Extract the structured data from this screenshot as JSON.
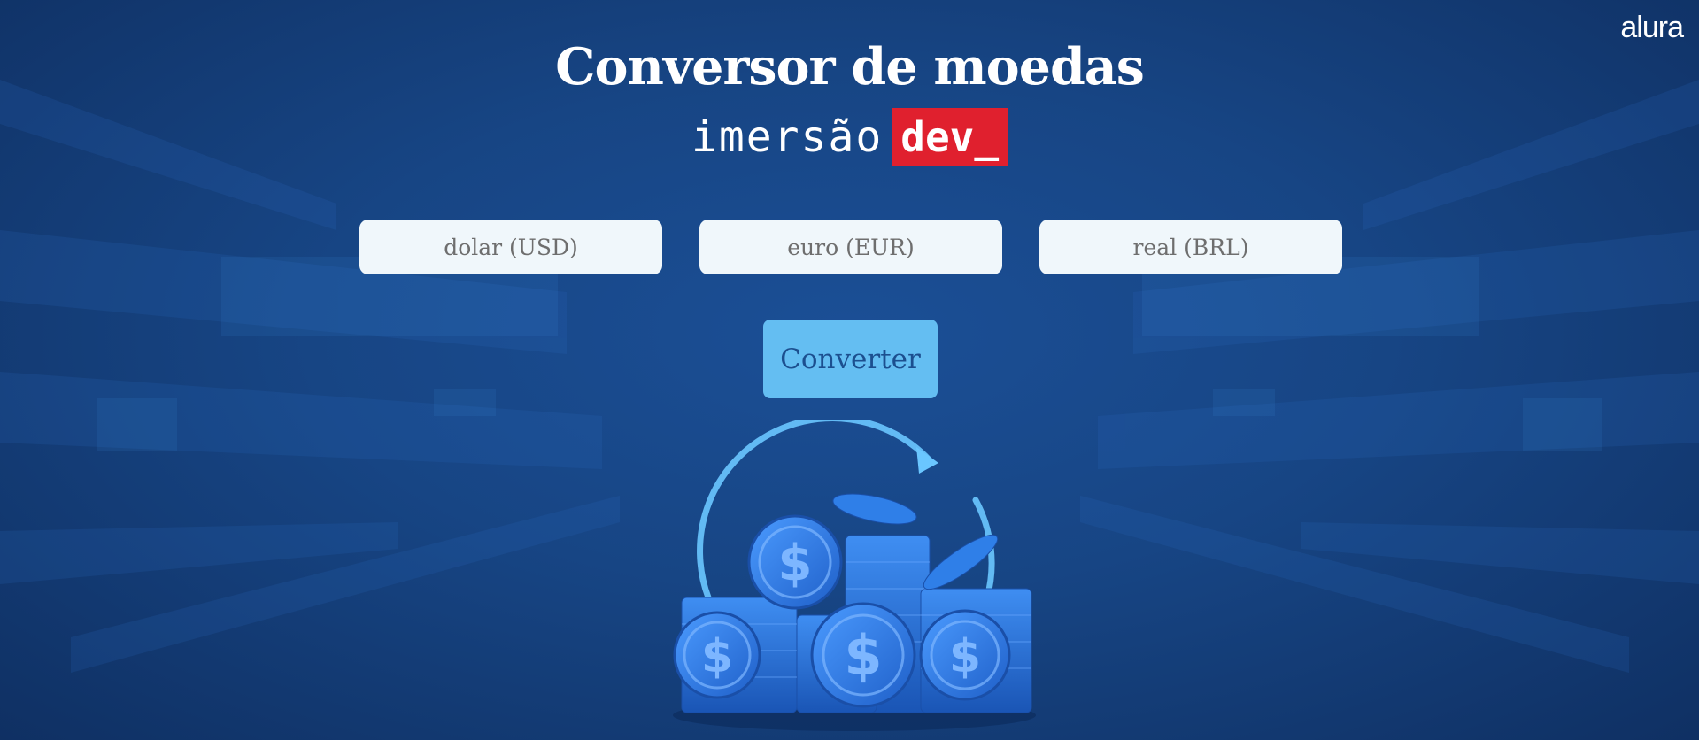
{
  "header": {
    "logo_text": "alura",
    "title": "Conversor de moedas",
    "subtitle_text": "imersão",
    "subtitle_badge": "dev_"
  },
  "form": {
    "fields": [
      {
        "placeholder": "dolar (USD)",
        "value": ""
      },
      {
        "placeholder": "euro (EUR)",
        "value": ""
      },
      {
        "placeholder": "real (BRL)",
        "value": ""
      }
    ],
    "button_label": "Converter"
  },
  "illustration": {
    "coin_symbol": "$",
    "icon": "coins-with-rotate-arrow-icon"
  },
  "colors": {
    "background": "#174584",
    "badge": "#e0202e",
    "input_bg": "#f0f7fb",
    "button_bg": "#64bef2",
    "button_text": "#1c4f8f",
    "coin": "#2f7fe8"
  }
}
